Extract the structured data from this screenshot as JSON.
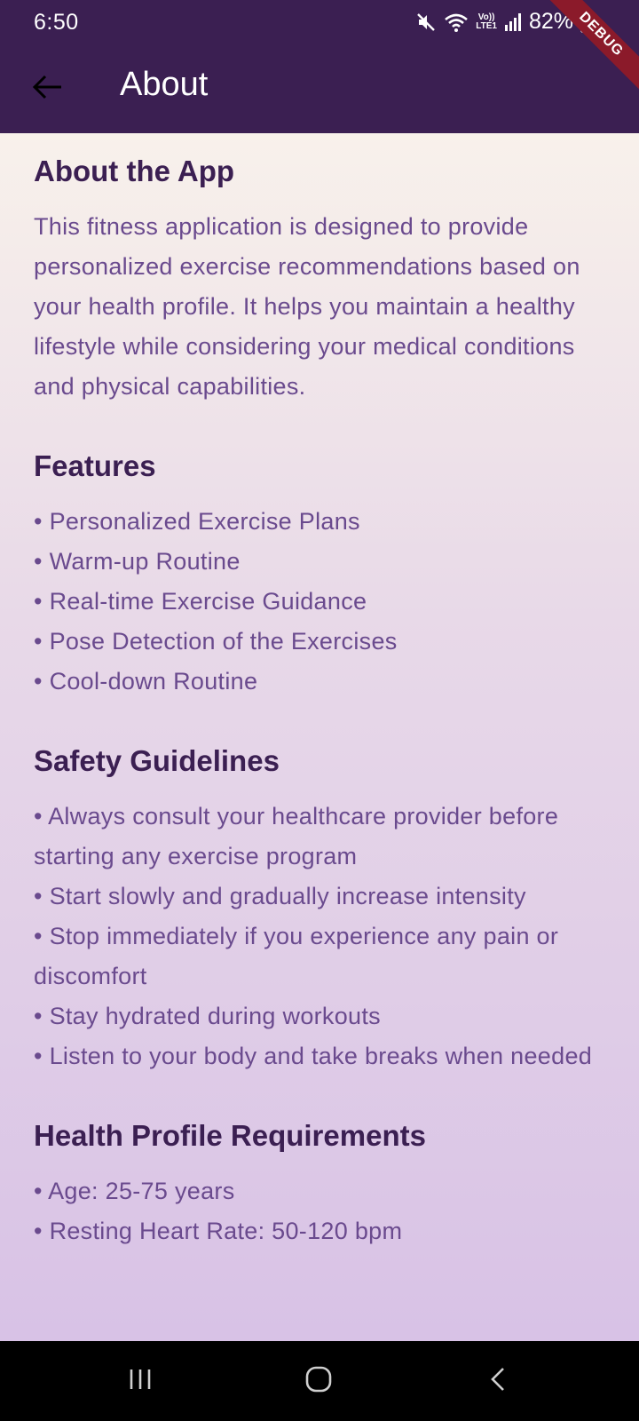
{
  "status_bar": {
    "time": "6:50",
    "volte_line1": "Vo))",
    "volte_line2": "LTE1",
    "battery": "82%",
    "icons": [
      "mute-icon",
      "wifi-icon",
      "signal-icon",
      "battery-icon"
    ]
  },
  "debug_banner": "DEBUG",
  "app_bar": {
    "title": "About",
    "back_icon": "arrow-left-icon"
  },
  "sections": {
    "about": {
      "title": "About the App",
      "body": "This fitness application is designed to provide personalized exercise recommendations based on your health profile. It helps you maintain a healthy lifestyle while considering your medical conditions and physical capabilities."
    },
    "features": {
      "title": "Features",
      "items": [
        "Personalized Exercise Plans",
        "Warm-up Routine",
        "Real-time Exercise Guidance",
        "Pose Detection of the Exercises",
        "Cool-down Routine"
      ]
    },
    "safety": {
      "title": "Safety Guidelines",
      "items": [
        "Always consult your healthcare provider before starting any exercise program",
        "Start slowly and gradually increase intensity",
        "Stop immediately if you experience any pain or discomfort",
        "Stay hydrated during workouts",
        "Listen to your body and take breaks when needed"
      ]
    },
    "health_profile": {
      "title": "Health Profile Requirements",
      "items": [
        "Age: 25-75 years",
        "Resting Heart Rate: 50-120 bpm"
      ]
    }
  },
  "nav_bar": {
    "icons": [
      "recent-apps-icon",
      "home-icon",
      "back-icon"
    ]
  },
  "colors": {
    "app_bar": "#3b1f52",
    "heading": "#3b1f52",
    "body_text": "#6a4a8e",
    "debug_ribbon": "#8b1a2a"
  }
}
